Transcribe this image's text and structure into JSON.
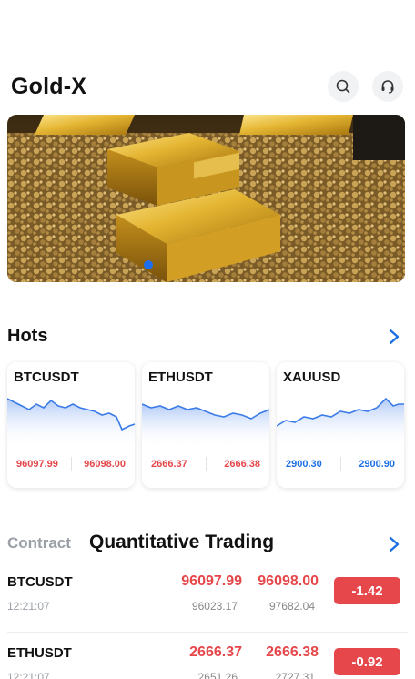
{
  "header": {
    "title": "Gold-X",
    "search_icon": "search-icon",
    "support_icon": "headset-icon"
  },
  "banner": {
    "active_slide": 1
  },
  "hots": {
    "title": "Hots",
    "cards": [
      {
        "symbol": "BTCUSDT",
        "value_left": "96097.99",
        "value_right": "96098.00",
        "color": "#e5474b"
      },
      {
        "symbol": "ETHUSDT",
        "value_left": "2666.37",
        "value_right": "2666.38",
        "color": "#e5474b"
      },
      {
        "symbol": "XAUUSD",
        "value_left": "2900.30",
        "value_right": "2900.90",
        "color": "#1d6fe6"
      }
    ]
  },
  "contract": {
    "tab_contract": "Contract",
    "tab_quant": "Quantitative Trading",
    "rows": [
      {
        "symbol": "BTCUSDT",
        "time": "12:21:07",
        "price1": "96097.99",
        "price2": "96098.00",
        "sub1": "96023.17",
        "sub2": "97682.04",
        "change": "-1.42"
      },
      {
        "symbol": "ETHUSDT",
        "time": "12:21:07",
        "price1": "2666.37",
        "price2": "2666.38",
        "sub1": "2651.26",
        "sub2": "2727.31",
        "change": "-0.92"
      }
    ]
  },
  "colors": {
    "up_red": "#e5474b",
    "accent_blue": "#1d6fe6",
    "muted": "#9aa0a6"
  }
}
